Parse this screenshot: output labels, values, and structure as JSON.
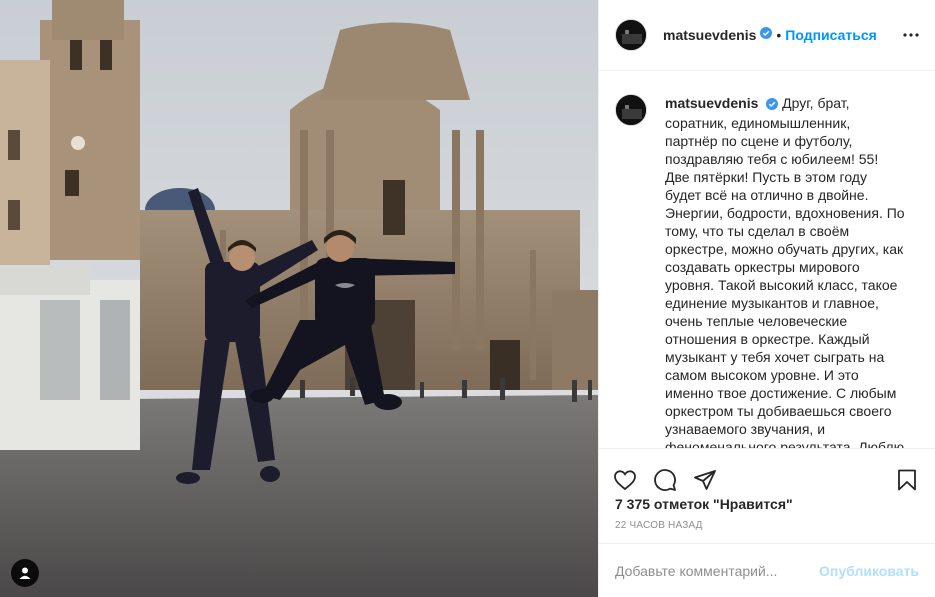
{
  "post": {
    "author": "matsuevdenis",
    "verified": true,
    "separator": "•",
    "follow_label": "Подписаться",
    "more_icon": "more-horizontal-icon",
    "caption_user": "matsuevdenis",
    "caption_text": "Друг, брат, соратник, единомышленник, партнёр по сцене и футболу, поздравляю тебя с юбилеем! 55! Две пятёрки! Пусть в этом году будет всё на отлично в двойне. Энергии, бодрости, вдохновения. По тому, что ты сделал в своём оркестре, можно обучать других, как создавать оркестры мирового уровня. Такой высокий класс, такое единение музыкантов и главное, очень теплые человеческие отношения в оркестре. Каждый музыкант у тебя хочет сыграть на самом высоком уровне. И это именно твое достижение. С любым оркестром ты добиваешься своего узнаваемого звучания, и феноменального результата. Люблю",
    "likes": "7 375 отметок \"Нравится\"",
    "time": "22 часов назад",
    "comment_placeholder": "Добавьте комментарий...",
    "publish_label": "Опубликовать"
  },
  "icons": {
    "like": "heart-icon",
    "comment": "comment-icon",
    "share": "paper-plane-icon",
    "save": "bookmark-icon",
    "tag": "user-tag-icon",
    "verified": "verified-badge-icon"
  },
  "colors": {
    "accent": "#0095f6",
    "accent_disabled": "#b2dffc",
    "muted": "#8e8e8e",
    "border": "#efefef"
  }
}
